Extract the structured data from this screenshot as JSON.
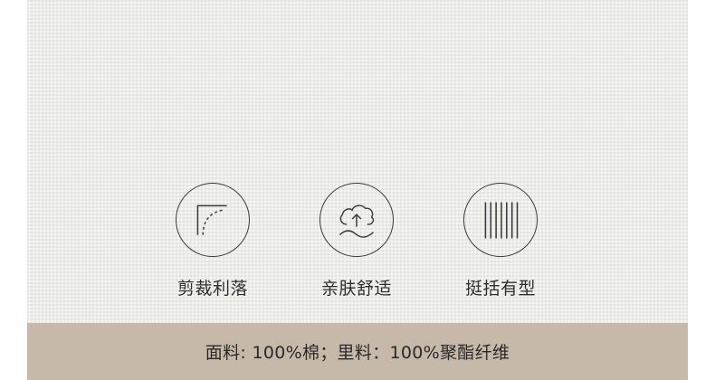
{
  "features": [
    {
      "icon": "tailoring-corner-icon",
      "label": "剪裁利落"
    },
    {
      "icon": "breathable-cloud-icon",
      "label": "亲肤舒适"
    },
    {
      "icon": "vertical-lines-icon",
      "label": "挺括有型"
    }
  ],
  "footer": {
    "material_text": "面料: 100%棉；里料：100%聚酯纤维"
  },
  "colors": {
    "panel": "#eeeee9",
    "footer": "#c7b9aa",
    "icon_stroke": "#3b3b3b",
    "text": "#2e2e2e"
  }
}
